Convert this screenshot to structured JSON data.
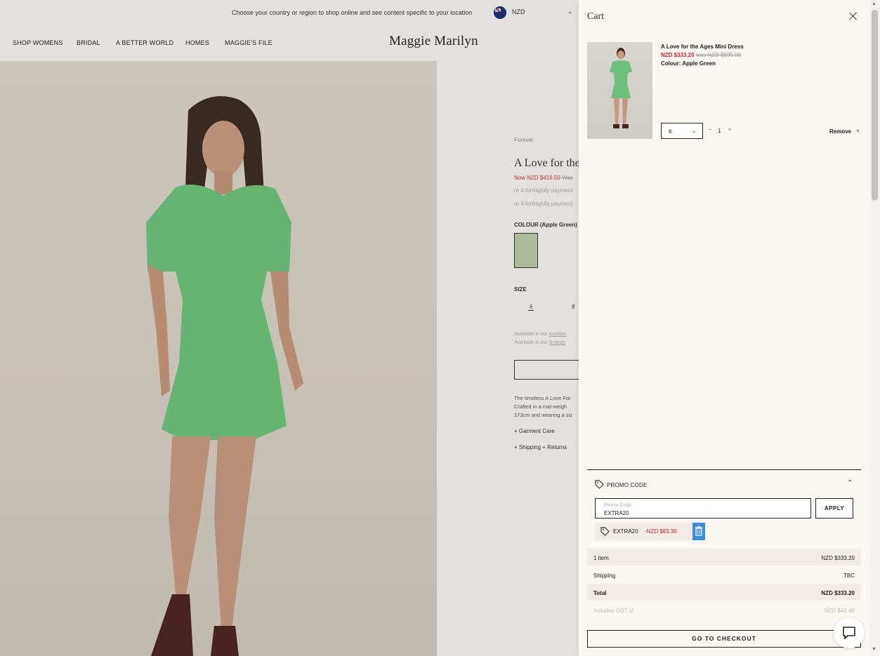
{
  "topbar": {
    "message": "Choose your country or region to shop online and see content specific to your location",
    "currency": "NZD"
  },
  "nav": {
    "items": [
      "SHOP WOMENS",
      "BRIDAL",
      "A BETTER WORLD",
      "HOMES",
      "MAGGIE'S FILE"
    ],
    "logo": "Maggie Marilyn"
  },
  "product": {
    "breadcrumb": "Forever",
    "title": "A Love for the",
    "price_now": "Now NZD $416.50",
    "price_was": "Was",
    "afterpay_1": "or 4 fortnightly payment",
    "afterpay_2": "or 4 fortnightly payment",
    "colour_label": "COLOUR (Apple Green)",
    "size_label": "SIZE",
    "sizes": [
      "6",
      "8"
    ],
    "available_1": "Available in our",
    "available_1_link": "Aucklan",
    "available_2": "Available in our",
    "available_2_link": "Sydney",
    "description_1": "The timeless A Love For",
    "description_2": "Crafted in a mid-weigh",
    "description_3": "173cm and wearing a siz",
    "accordion_1": "Garment Care",
    "accordion_2": "Shipping + Returns"
  },
  "cart": {
    "title": "Cart",
    "item": {
      "name": "A Love for the Ages Mini Dress",
      "price_now": "NZD $333.20",
      "price_was": "was NZD $595.00",
      "colour": "Colour: Apple Green",
      "size": "6",
      "quantity": "1",
      "qty_minus": "−",
      "qty_plus": "+",
      "remove_label": "Remove",
      "remove_x": "×"
    },
    "promo": {
      "label": "PROMO CODE",
      "placeholder": "Promo Code",
      "value": "EXTRA20",
      "apply_label": "APPLY",
      "applied_code": "EXTRA20",
      "applied_discount": "-NZD $83.30"
    },
    "summary": [
      {
        "label": "1 item",
        "value": "NZD $333.20"
      },
      {
        "label": "Shipping",
        "value": "TBC"
      },
      {
        "label": "Total",
        "value": "NZD $333.20"
      },
      {
        "label": "Includes GST of",
        "value": "NZD $43.46"
      }
    ],
    "checkout_label": "GO TO CHECKOUT"
  },
  "icons": {
    "close": "close-icon",
    "tag": "tag-icon",
    "chevron": "chevron-down-icon",
    "trash": "trash-icon",
    "chat": "chat-icon"
  },
  "colors": {
    "sale_red": "#c6262e",
    "drawer_bg": "#faf6f1",
    "trash_blue": "#3b8fd8",
    "dress_green": "#6cc07a"
  }
}
